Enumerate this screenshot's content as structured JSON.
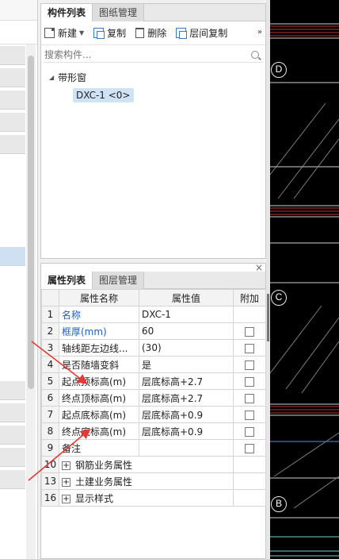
{
  "component_panel": {
    "tabs": [
      "构件列表",
      "图纸管理"
    ],
    "toolbar": {
      "new_label": "新建",
      "copy_label": "复制",
      "delete_label": "删除",
      "floor_copy_label": "层间复制",
      "more": "»"
    },
    "search_placeholder": "搜索构件...",
    "tree": {
      "group_label": "带形窗",
      "item_label": "DXC-1 <0>"
    }
  },
  "property_panel": {
    "close": "×",
    "tabs": [
      "属性列表",
      "图层管理"
    ],
    "headers": {
      "name": "属性名称",
      "value": "属性值",
      "extra": "附加"
    },
    "rows": [
      {
        "idx": "1",
        "name": "名称",
        "value": "DXC-1",
        "blue": true,
        "checkbox": false
      },
      {
        "idx": "2",
        "name": "框厚(mm)",
        "value": "60",
        "blue": true,
        "checkbox": true
      },
      {
        "idx": "3",
        "name": "轴线距左边线...",
        "value": "(30)",
        "blue": false,
        "checkbox": true
      },
      {
        "idx": "4",
        "name": "是否随墙变斜",
        "value": "是",
        "blue": false,
        "checkbox": true
      },
      {
        "idx": "5",
        "name": "起点顶标高(m)",
        "value": "层底标高+2.7",
        "blue": false,
        "checkbox": true
      },
      {
        "idx": "6",
        "name": "终点顶标高(m)",
        "value": "层底标高+2.7",
        "blue": false,
        "checkbox": true
      },
      {
        "idx": "7",
        "name": "起点底标高(m)",
        "value": "层底标高+0.9",
        "blue": false,
        "checkbox": true
      },
      {
        "idx": "8",
        "name": "终点底标高(m)",
        "value": "层底标高+0.9",
        "blue": false,
        "checkbox": true
      },
      {
        "idx": "9",
        "name": "备注",
        "value": "",
        "blue": false,
        "checkbox": true
      }
    ],
    "groups": [
      {
        "idx": "10",
        "name": "钢筋业务属性"
      },
      {
        "idx": "13",
        "name": "土建业务属性"
      },
      {
        "idx": "16",
        "name": "显示样式"
      }
    ]
  },
  "canvas": {
    "axis_labels": [
      "D",
      "C",
      "B"
    ],
    "colors": {
      "background": "#000000",
      "wall_red": "#c0392b",
      "axis_blue": "#3a6fd8",
      "line_cyan": "#6fd3d3"
    }
  },
  "annotations": {
    "arrow_color": "#e53935"
  }
}
